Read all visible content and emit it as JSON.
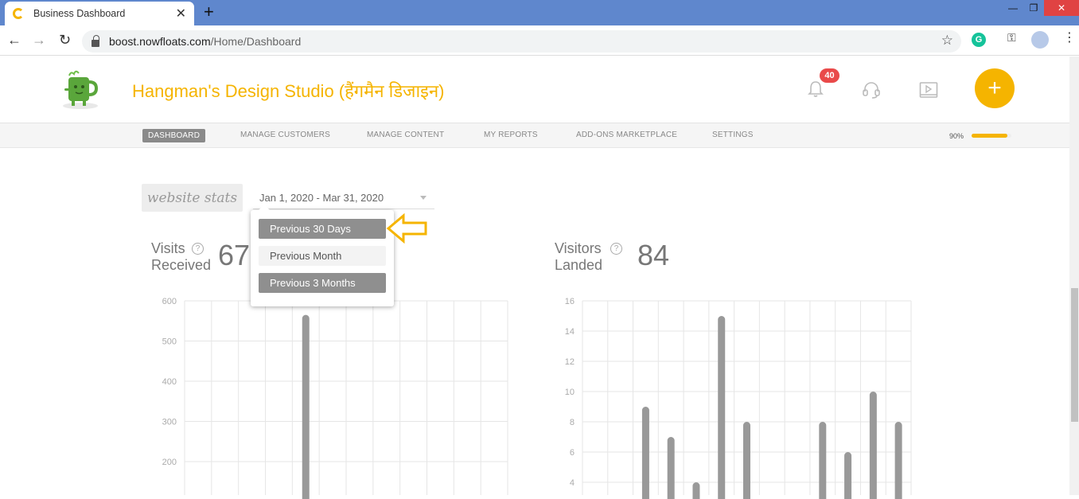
{
  "browser": {
    "tab_title": "Business Dashboard",
    "url_host": "boost.nowfloats.com",
    "url_path": "/Home/Dashboard",
    "new_tab": "+",
    "ext_grammarly": "G"
  },
  "header": {
    "business_name": "Hangman's Design Studio (हैंगमैन डिजाइन)",
    "notification_count": "40",
    "fab_label": "+"
  },
  "nav": {
    "items": [
      {
        "label": "DASHBOARD",
        "active": true
      },
      {
        "label": "MANAGE CUSTOMERS"
      },
      {
        "label": "MANAGE CONTENT"
      },
      {
        "label": "MY REPORTS"
      },
      {
        "label": "ADD-ONS MARKETPLACE"
      },
      {
        "label": "SETTINGS"
      }
    ],
    "profile_progress_text": "90%",
    "profile_progress": 0.9
  },
  "stats": {
    "section_label": "website stats",
    "date_range": "Jan 1, 2020 - Mar 31, 2020",
    "dropdown_options": [
      "Previous 30 Days",
      "Previous Month",
      "Previous 3 Months"
    ],
    "visits_label_1": "Visits",
    "visits_label_2": "Received",
    "visits_value": "67",
    "visitors_label_1": "Visitors",
    "visitors_label_2": "Landed",
    "visitors_value": "84",
    "help_glyph": "?"
  },
  "chart_data": [
    {
      "type": "bar",
      "ylim": [
        0,
        600
      ],
      "yticks": [
        600,
        500,
        400,
        300,
        200
      ],
      "values": [
        0,
        0,
        0,
        0,
        565,
        0,
        0,
        0,
        0,
        0,
        0,
        0
      ],
      "color": "#999999"
    },
    {
      "type": "bar",
      "ylim": [
        0,
        16
      ],
      "yticks": [
        16,
        14,
        12,
        10,
        8,
        6,
        4
      ],
      "values": [
        0,
        0,
        9,
        7,
        4,
        15,
        8,
        0,
        0,
        8,
        6,
        10,
        8
      ],
      "color": "#999999"
    }
  ],
  "colors": {
    "accent": "#f5b400",
    "badge": "#e94a4a",
    "nav_active": "#8a8a8a"
  }
}
